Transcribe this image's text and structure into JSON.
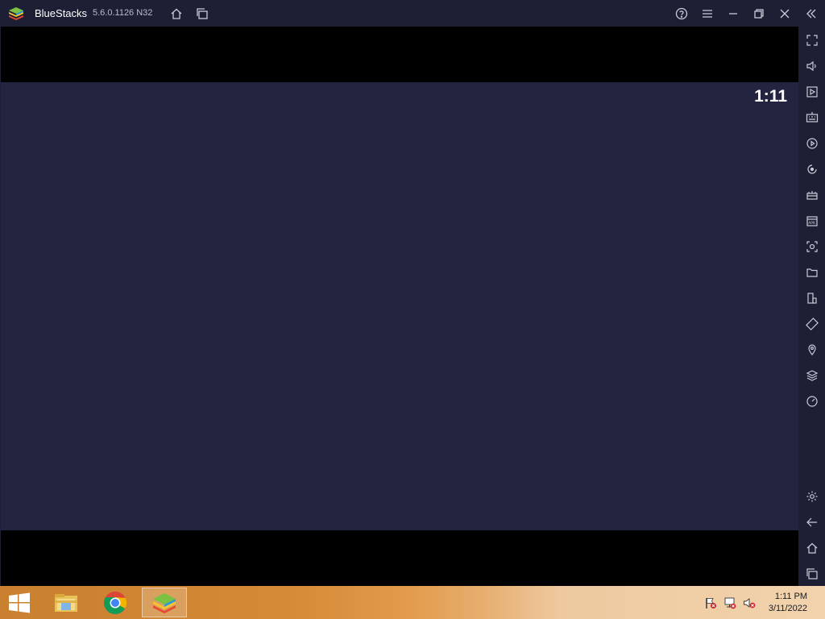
{
  "window": {
    "app_name": "BlueStacks",
    "version": "5.6.0.1126  N32"
  },
  "titlebar_buttons": [
    "home-icon",
    "multi-instance-icon",
    "help-icon",
    "menu-icon",
    "minimize-icon",
    "restore-icon",
    "close-icon",
    "collapse-sidebar-icon"
  ],
  "sidebar_tools": [
    "fullscreen-icon",
    "volume-icon",
    "media-import-icon",
    "keyboard-controls-icon",
    "macro-recorder-icon",
    "realtime-translation-icon",
    "game-controls-icon",
    "install-apk-icon",
    "screenshot-icon",
    "media-folder-icon",
    "multi-instance-manager-icon",
    "rotate-icon",
    "location-icon",
    "layers-icon",
    "eco-mode-icon",
    "settings-icon",
    "back-icon",
    "android-home-icon",
    "recent-apps-icon"
  ],
  "android": {
    "clock": "1:11"
  },
  "taskbar": {
    "apps": [
      "file-explorer-icon",
      "chrome-icon",
      "bluestacks-icon"
    ],
    "active_app": "bluestacks-icon",
    "tray": [
      "action-center-flag-icon",
      "network-icon",
      "volume-muted-icon"
    ],
    "time": "1:11 PM",
    "date": "3/11/2022"
  },
  "colors": {
    "titlebar": "#1d2035",
    "content": "#23243f",
    "taskbar_start": "#c9802f",
    "taskbar_end": "#f1d3ad"
  }
}
